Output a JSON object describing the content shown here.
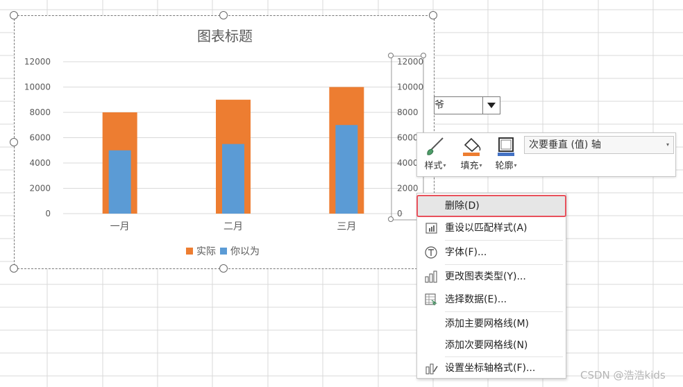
{
  "chart": {
    "title": "图表标题",
    "legend": [
      "实际",
      "你以为"
    ],
    "secondary_axis_ticks": [
      "12000",
      "10000",
      "8000",
      "6000",
      "4000",
      "2000",
      "0"
    ]
  },
  "chart_data": {
    "type": "bar",
    "title": "图表标题",
    "categories": [
      "一月",
      "二月",
      "三月"
    ],
    "series": [
      {
        "name": "实际",
        "values": [
          8000,
          9000,
          10000
        ],
        "color": "#ed7d31"
      },
      {
        "name": "你以为",
        "values": [
          5000,
          5500,
          7000
        ],
        "color": "#5b9bd5"
      }
    ],
    "ylim": [
      0,
      12000
    ],
    "yticks": [
      0,
      2000,
      4000,
      6000,
      8000,
      10000,
      12000
    ],
    "secondary_ylim": [
      0,
      12000
    ],
    "grid": true,
    "legend_position": "bottom"
  },
  "cell_combo": {
    "text": "爷",
    "arrow_icon": "triangle-down-icon"
  },
  "mini_toolbar": {
    "style_label": "样式",
    "fill_label": "填充",
    "outline_label": "轮廓",
    "element_selected": "次要垂直 (值) 轴",
    "caret": "▾",
    "fill_color": "#ed7d31",
    "outline_color": "#4472c4"
  },
  "context_menu": {
    "items": [
      {
        "label": "删除(D)",
        "icon": null
      },
      {
        "label": "重设以匹配样式(A)",
        "icon": "reset-style-icon"
      },
      {
        "label": "字体(F)...",
        "icon": "font-icon"
      },
      {
        "label": "更改图表类型(Y)...",
        "icon": "chart-type-icon"
      },
      {
        "label": "选择数据(E)...",
        "icon": "select-data-icon"
      },
      {
        "label": "添加主要网格线(M)",
        "icon": null
      },
      {
        "label": "添加次要网格线(N)",
        "icon": null
      },
      {
        "label": "设置坐标轴格式(F)...",
        "icon": "format-axis-icon"
      }
    ]
  },
  "watermark": "CSDN @浩浩kids",
  "colors": {
    "accent_highlight": "#e8505b",
    "gridline": "#d9d9d9"
  }
}
